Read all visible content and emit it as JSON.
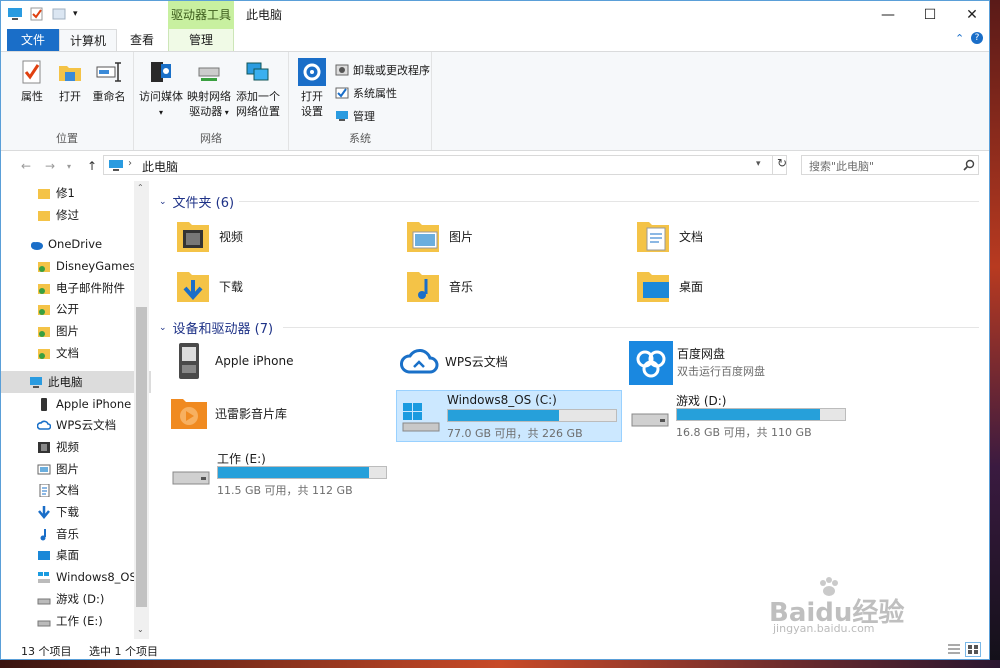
{
  "window": {
    "title": "此电脑",
    "context_tab": "驱动器工具"
  },
  "tabs": {
    "file": "文件",
    "computer": "计算机",
    "view": "查看",
    "manage": "管理"
  },
  "ribbon": {
    "groups": {
      "location": "位置",
      "network": "网络",
      "system": "系统"
    },
    "properties": "属性",
    "open": "打开",
    "rename": "重命名",
    "access_media": "访问媒体",
    "map_drive_1": "映射网络",
    "map_drive_2": "驱动器",
    "add_location_1": "添加一个",
    "add_location_2": "网络位置",
    "open_settings_1": "打开",
    "open_settings_2": "设置",
    "uninstall": "卸载或更改程序",
    "system_props": "系统属性",
    "manage": "管理"
  },
  "address": {
    "path": "此电脑",
    "search_placeholder": "搜索\"此电脑\""
  },
  "nav": {
    "items": [
      {
        "label": "修1"
      },
      {
        "label": "修过"
      },
      {
        "label": "OneDrive"
      },
      {
        "label": "DisneyGames"
      },
      {
        "label": "电子邮件附件"
      },
      {
        "label": "公开"
      },
      {
        "label": "图片"
      },
      {
        "label": "文档"
      },
      {
        "label": "此电脑"
      },
      {
        "label": "Apple iPhone"
      },
      {
        "label": "WPS云文档"
      },
      {
        "label": "视频"
      },
      {
        "label": "图片"
      },
      {
        "label": "文档"
      },
      {
        "label": "下载"
      },
      {
        "label": "音乐"
      },
      {
        "label": "桌面"
      },
      {
        "label": "Windows8_OS"
      },
      {
        "label": "游戏 (D:)"
      },
      {
        "label": "工作 (E:)"
      }
    ]
  },
  "folders": {
    "header": "文件夹 (6)",
    "items": [
      "视频",
      "图片",
      "文档",
      "下载",
      "音乐",
      "桌面"
    ]
  },
  "devices": {
    "header": "设备和驱动器 (7)",
    "apple": "Apple iPhone",
    "wps": "WPS云文档",
    "baidu": "百度网盘",
    "baidu_sub": "双击运行百度网盘",
    "xunlei": "迅雷影音片库",
    "drives": [
      {
        "name": "Windows8_OS (C:)",
        "free": "77.0 GB 可用，共 226 GB",
        "used_fraction": 0.66
      },
      {
        "name": "游戏 (D:)",
        "free": "16.8 GB 可用，共 110 GB",
        "used_fraction": 0.85
      },
      {
        "name": "工作 (E:)",
        "free": "11.5 GB 可用，共 112 GB",
        "used_fraction": 0.9
      }
    ]
  },
  "status": {
    "count": "13 个项目",
    "selected": "选中 1 个项目"
  },
  "watermark": {
    "brand": "Baidu经验",
    "url": "jingyan.baidu.com"
  }
}
